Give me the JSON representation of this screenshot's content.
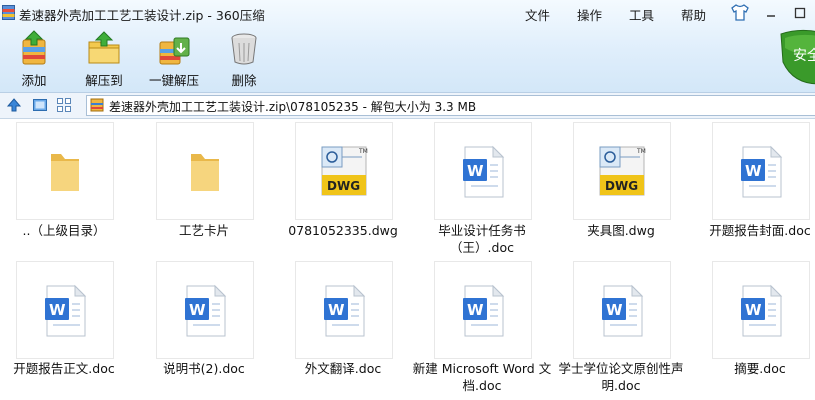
{
  "window": {
    "title": "差速器外壳加工工艺工装设计.zip - 360压缩",
    "menu": [
      "文件",
      "操作",
      "工具",
      "帮助"
    ]
  },
  "toolbar": {
    "add": "添加",
    "extract_to": "解压到",
    "one_click_extract": "一键解压",
    "delete": "删除",
    "security_label": "安全"
  },
  "address": {
    "path": "差速器外壳加工工艺工装设计.zip\\078105235 - 解包大小为 3.3 MB"
  },
  "files": [
    {
      "name": "..（上级目录）",
      "type": "folder"
    },
    {
      "name": "工艺卡片",
      "type": "folder"
    },
    {
      "name": "0781052335.dwg",
      "type": "dwg"
    },
    {
      "name": "毕业设计任务书（王）.doc",
      "type": "doc"
    },
    {
      "name": "夹具图.dwg",
      "type": "dwg"
    },
    {
      "name": "开题报告封面.doc",
      "type": "doc"
    },
    {
      "name": "开题报告正文.doc",
      "type": "doc"
    },
    {
      "name": "说明书(2).doc",
      "type": "doc"
    },
    {
      "name": "外文翻译.doc",
      "type": "doc"
    },
    {
      "name": "新建 Microsoft Word 文档.doc",
      "type": "doc"
    },
    {
      "name": "学士学位论文原创性声明.doc",
      "type": "doc"
    },
    {
      "name": "摘要.doc",
      "type": "doc"
    }
  ],
  "icons": {
    "dwg_badge": "DWG",
    "doc_badge": "W",
    "tm": "TM"
  },
  "colors": {
    "title_gradient_top": "#f4faff",
    "title_gradient_bottom": "#d3e7f8",
    "word_blue": "#2f73d3",
    "dwg_yellow": "#f0c419",
    "folder_yellow": "#f3d27a",
    "security_green": "#3a9a2a"
  }
}
